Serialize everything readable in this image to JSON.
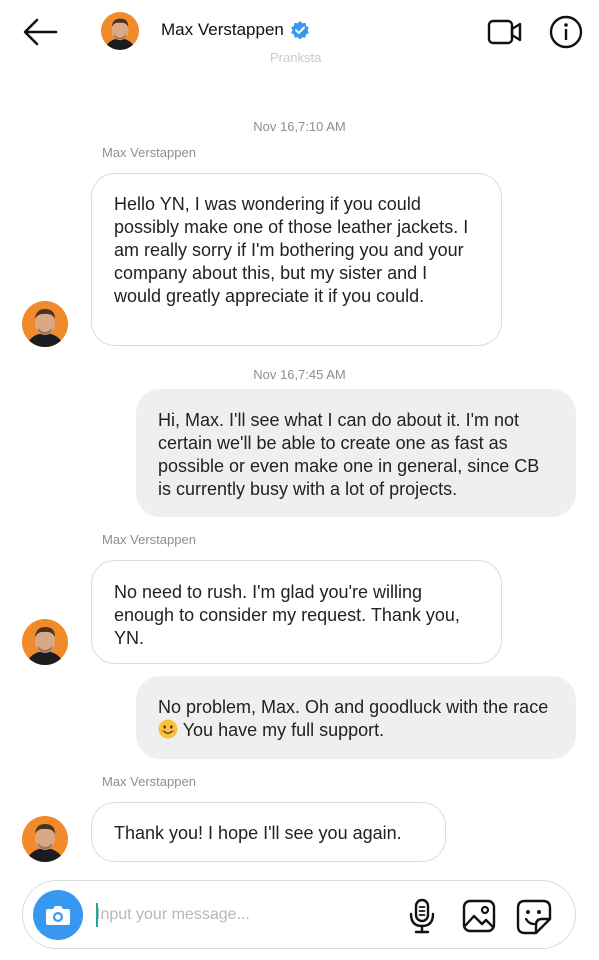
{
  "header": {
    "title": "Max Verstappen",
    "subtitle": "Pranksta",
    "verified_color": "#3897f0",
    "back_icon": "arrow-left-icon",
    "video_icon": "video-camera-icon",
    "info_icon": "info-icon"
  },
  "messages": [
    {
      "type": "timestamp",
      "text": "Nov 16,7:10 AM"
    },
    {
      "type": "sender",
      "text": "Max Verstappen"
    },
    {
      "type": "incoming",
      "text": "Hello YN, I was wondering if you could possibly make one of those leather jackets. I am really sorry if I'm bothering you and your company about this, but my sister and I would greatly appreciate it if you could."
    },
    {
      "type": "timestamp",
      "text": "Nov 16,7:45 AM"
    },
    {
      "type": "outgoing",
      "text": "Hi, Max. I'll see what I can do about it. I'm not certain we'll be able to create one as fast as possible or even make one in general, since CB is currently busy with a lot of projects."
    },
    {
      "type": "sender",
      "text": "Max Verstappen"
    },
    {
      "type": "incoming",
      "text": "No need to rush. I'm glad you're willing enough to consider my request. Thank you, YN."
    },
    {
      "type": "outgoing",
      "text_before_emoji": "No problem, Max. Oh and goodluck with the race",
      "emoji": "smiling-face-emoji",
      "text_after_emoji": "You have my full support."
    },
    {
      "type": "sender",
      "text": "Max Verstappen"
    },
    {
      "type": "incoming",
      "text": "Thank you! I hope I'll see you again."
    }
  ],
  "composer": {
    "placeholder": "Input your message...",
    "value": "",
    "camera_icon": "camera-icon",
    "mic_icon": "microphone-icon",
    "gallery_icon": "image-icon",
    "sticker_icon": "sticker-icon",
    "accent_color": "#3897f0"
  },
  "colors": {
    "outgoing_bubble": "#efefef",
    "incoming_border": "#dcdcdc",
    "meta_text": "#8e8e8e"
  }
}
